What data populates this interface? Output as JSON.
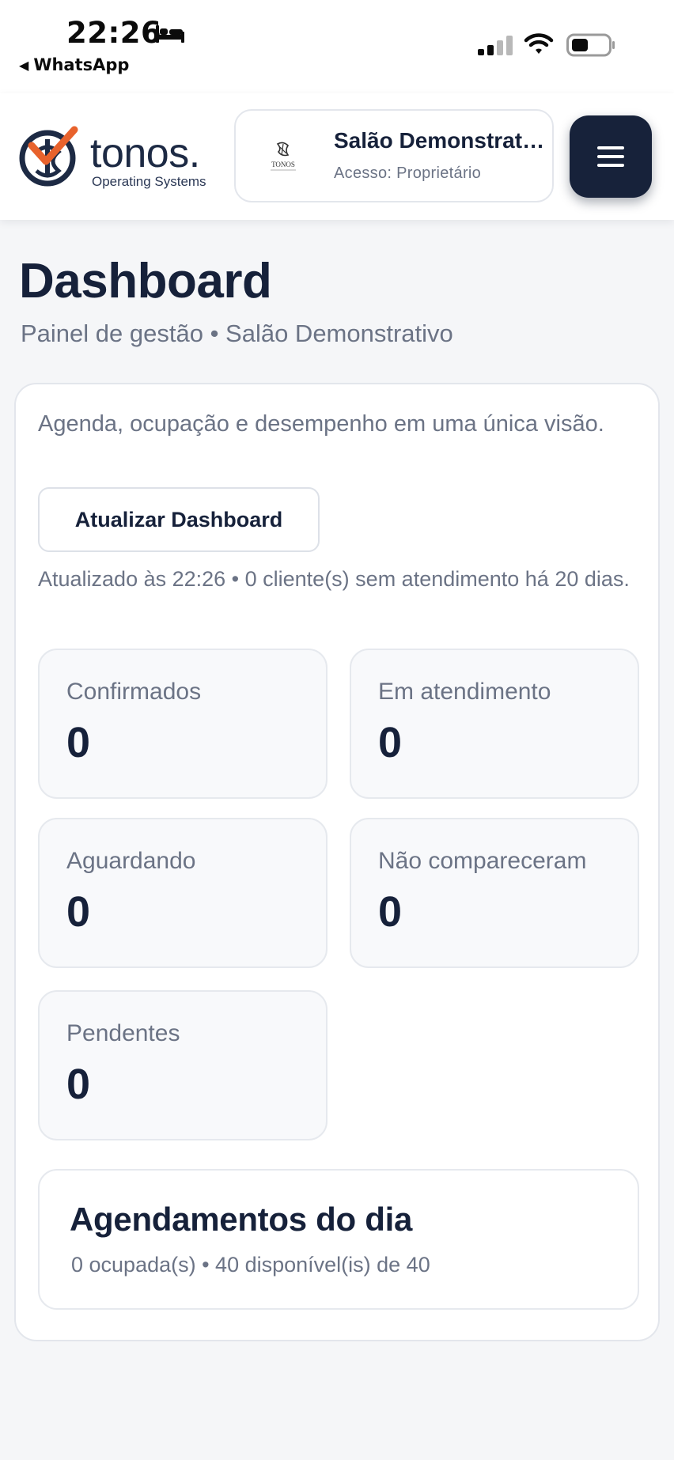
{
  "status_bar": {
    "time": "22:26",
    "back_label": "WhatsApp",
    "icons": [
      "bed-icon",
      "signal-icon",
      "wifi-icon",
      "battery-icon"
    ]
  },
  "header": {
    "brand_name": "tonos.",
    "brand_tagline": "Operating Systems",
    "salon": {
      "name": "Salão Demonstrativo",
      "access": "Acesso: Proprietário",
      "logo_text": "TONOS"
    },
    "menu_icon": "hamburger-menu-icon"
  },
  "page": {
    "title": "Dashboard",
    "subtitle": "Painel de gestão • Salão Demonstrativo"
  },
  "dashboard": {
    "description": "Agenda, ocupação e desempenho em uma única visão.",
    "refresh_label": "Atualizar Dashboard",
    "updated_text": "Atualizado às 22:26 • 0 cliente(s) sem atendimento há 20 dias.",
    "stats": [
      {
        "label": "Confirmados",
        "value": "0"
      },
      {
        "label": "Em atendimento",
        "value": "0"
      },
      {
        "label": "Aguardando",
        "value": "0"
      },
      {
        "label": "Não compareceram",
        "value": "0"
      },
      {
        "label": "Pendentes",
        "value": "0"
      }
    ],
    "appointments": {
      "title": "Agendamentos do dia",
      "summary": "0 ocupada(s) • 40 disponível(is) de 40"
    }
  },
  "colors": {
    "primary_dark": "#17223a",
    "accent_orange": "#e8622c",
    "muted_text": "#6b7385",
    "background": "#f5f6f8"
  }
}
